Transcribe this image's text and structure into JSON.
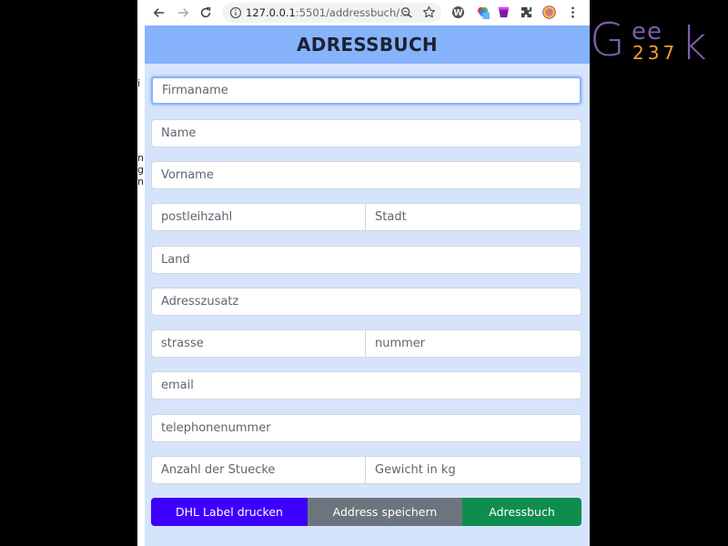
{
  "browser": {
    "url_host": "127.0.0.1",
    "url_rest": ":5501/addressbuch/..."
  },
  "app": {
    "title": "ADRESSBUCH",
    "fields": {
      "firmaname": "Firmaname",
      "name": "Name",
      "vorname": "Vorname",
      "postleihzahl": "postleihzahl",
      "stadt": "Stadt",
      "land": "Land",
      "adresszusatz": "Adresszusatz",
      "strasse": "strasse",
      "nummer": "nummer",
      "email": "email",
      "telephonenummer": "telephonenummer",
      "anzahl": "Anzahl der Stuecke",
      "gewicht": "Gewicht in kg"
    },
    "buttons": {
      "dhl": "DHL Label drucken",
      "save": "Address speichern",
      "book": "Adressbuch"
    }
  },
  "logo": {
    "word": "Geek",
    "number": "237"
  },
  "colors": {
    "header": "#86b3fb",
    "background": "#d6e4fb",
    "dhl_button": "#3d00fe",
    "save_button": "#6c757d",
    "book_button": "#0e8d4e",
    "logo_purple": "#7b5ea8",
    "logo_orange": "#f0a030"
  }
}
